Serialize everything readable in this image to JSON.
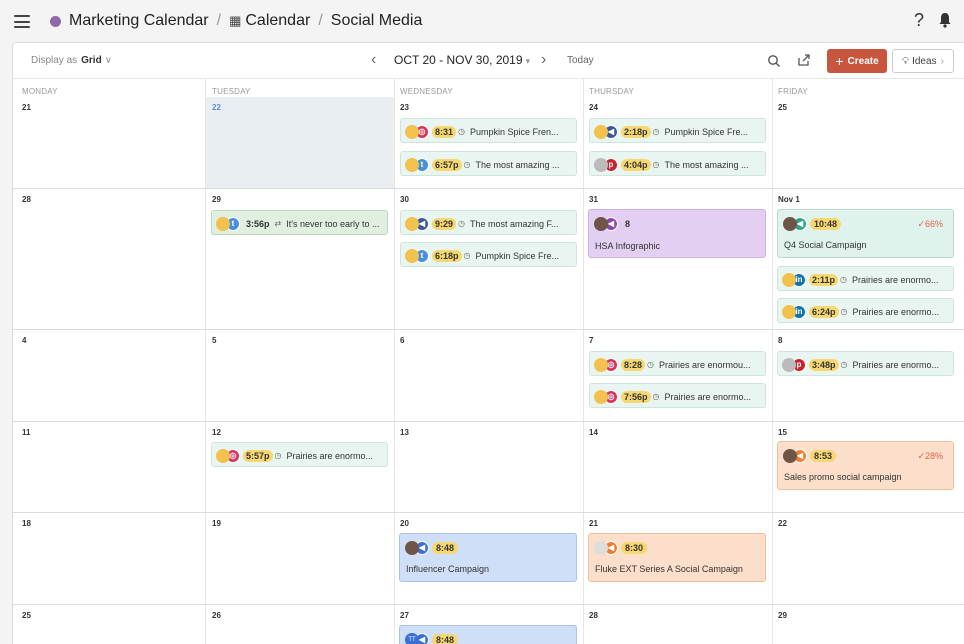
{
  "header": {
    "crumb1": "Marketing Calendar",
    "crumb2": "Calendar",
    "crumb3": "Social Media",
    "separator": "/",
    "help": "?"
  },
  "toolbar": {
    "display_label": "Display as",
    "display_value": "Grid",
    "date_range": "OCT 20 - NOV 30, 2019",
    "today": "Today",
    "create": "Create",
    "ideas": "Ideas"
  },
  "days": [
    "MONDAY",
    "TUESDAY",
    "WEDNESDAY",
    "THURSDAY",
    "FRIDAY"
  ],
  "dates": {
    "w1": [
      "21",
      "22",
      "23",
      "24",
      "25"
    ],
    "w2": [
      "28",
      "29",
      "30",
      "31",
      "Nov 1"
    ],
    "w3": [
      "4",
      "5",
      "6",
      "7",
      "8"
    ],
    "w4": [
      "11",
      "12",
      "13",
      "14",
      "15"
    ],
    "w5": [
      "18",
      "19",
      "20",
      "21",
      "22"
    ],
    "w6": [
      "25",
      "26",
      "27",
      "28",
      "29"
    ]
  },
  "events": {
    "e1": {
      "time": "8:31",
      "title": "Pumpkin Spice Fren..."
    },
    "e2": {
      "time": "6:57p",
      "title": "The most amazing ..."
    },
    "e3": {
      "time": "2:18p",
      "title": "Pumpkin Spice Fre..."
    },
    "e4": {
      "time": "4:04p",
      "title": "The most amazing ..."
    },
    "e5": {
      "time": "3:56p",
      "title": "It's never too early to ..."
    },
    "e6": {
      "time": "9:29",
      "title": "The most amazing F..."
    },
    "e7": {
      "time": "6:18p",
      "title": "Pumpkin Spice Fre..."
    },
    "e8": {
      "time": "2:11p",
      "title": "Prairies are enormo..."
    },
    "e9": {
      "time": "6:24p",
      "title": "Prairies are enormo..."
    },
    "e10": {
      "time": "8:28",
      "title": "Prairies are enormou..."
    },
    "e11": {
      "time": "7:56p",
      "title": "Prairies are enormo..."
    },
    "e12": {
      "time": "3:48p",
      "title": "Prairies are enormo..."
    },
    "e13": {
      "time": "5:57p",
      "title": "Prairies are enormo..."
    }
  },
  "campaigns": {
    "hsa": {
      "count": "8",
      "title": "HSA Infographic"
    },
    "q4": {
      "time": "10:48",
      "title": "Q4 Social Campaign",
      "percent": "✓66%"
    },
    "sales": {
      "time": "8:53",
      "title": "Sales promo social campaign",
      "percent": "✓28%"
    },
    "influencer": {
      "time": "8:48",
      "title": "Influencer Campaign"
    },
    "fluke": {
      "time": "8:30",
      "title": "Fluke EXT Series A Social Campaign"
    },
    "c27": {
      "time": "8:48",
      "initials": "TT"
    }
  },
  "colors": {
    "create": "#c8553d",
    "today_cell": "#e9eef3",
    "crumb_dot": "#8e6aa8"
  }
}
